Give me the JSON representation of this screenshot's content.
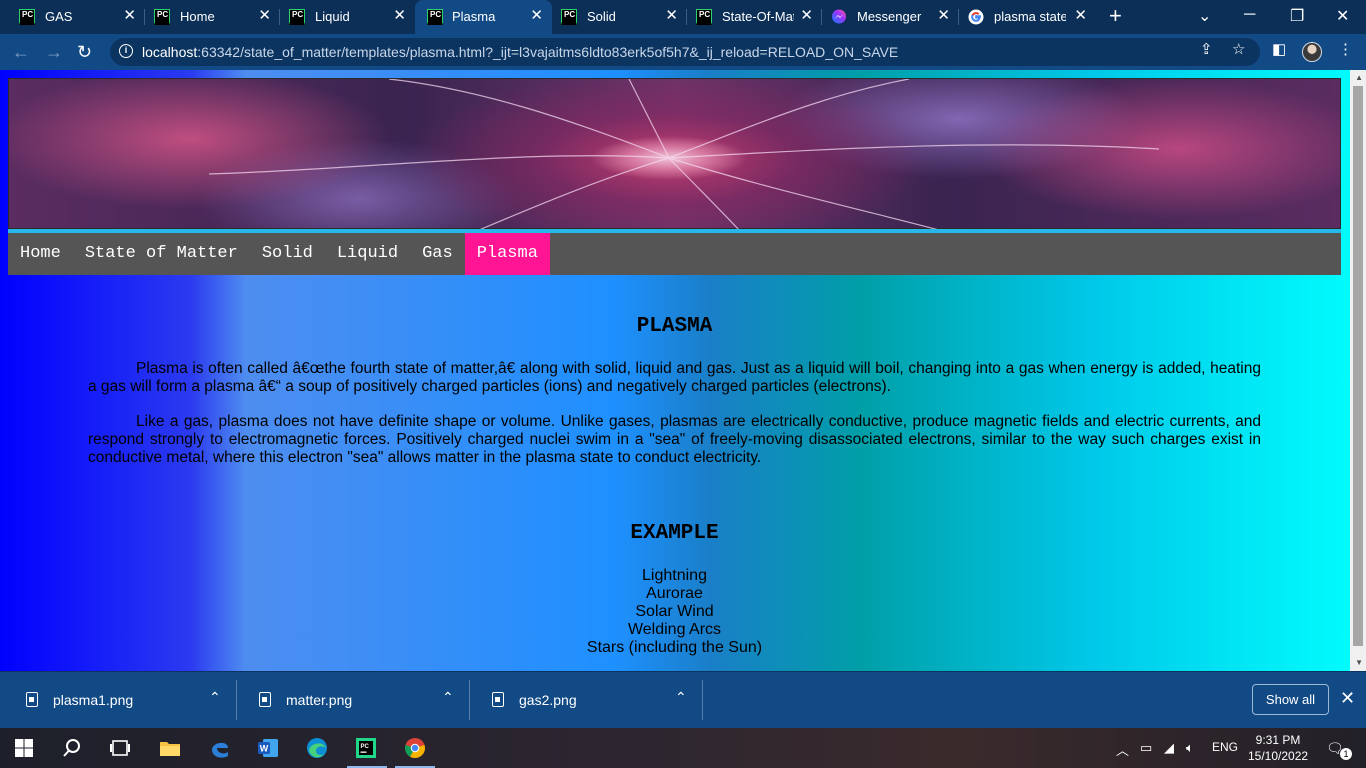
{
  "browser": {
    "tabs": [
      {
        "title": "GAS",
        "icon": "pycharm-icon",
        "active": false
      },
      {
        "title": "Home",
        "icon": "pycharm-icon",
        "active": false
      },
      {
        "title": "Liquid",
        "icon": "pycharm-icon",
        "active": false
      },
      {
        "title": "Plasma",
        "icon": "pycharm-icon",
        "active": true
      },
      {
        "title": "Solid",
        "icon": "pycharm-icon",
        "active": false
      },
      {
        "title": "State-Of-Matt",
        "icon": "pycharm-icon",
        "active": false
      },
      {
        "title": "Messenger",
        "icon": "messenger-icon",
        "active": false
      },
      {
        "title": "plasma state",
        "icon": "google-icon",
        "active": false
      }
    ],
    "url_host": "localhost",
    "url_rest": ":63342/state_of_matter/templates/plasma.html?_ijt=l3vajaitms6ldto83erk5of5h7&_ij_reload=RELOAD_ON_SAVE"
  },
  "page": {
    "nav": [
      "Home",
      "State of Matter",
      "Solid",
      "Liquid",
      "Gas",
      "Plasma"
    ],
    "active_nav": "Plasma",
    "heading": "PLASMA",
    "paragraph1": "Plasma is often called â€œthe fourth state of matter,â€ along with solid, liquid and gas. Just as a liquid will boil, changing into a gas when energy is added, heating a gas will form a plasma â€“ a soup of positively charged particles (ions) and negatively charged particles (electrons).",
    "paragraph2": "Like a gas, plasma does not have definite shape or volume. Unlike gases, plasmas are electrically conductive, produce magnetic fields and electric currents, and respond strongly to electromagnetic forces. Positively charged nuclei swim in a \"sea\" of freely-moving disassociated electrons, similar to the way such charges exist in conductive metal, where this electron \"sea\" allows matter in the plasma state to conduct electricity.",
    "example_heading": "EXAMPLE",
    "examples": [
      "Lightning",
      "Aurorae",
      "Solar Wind",
      "Welding Arcs",
      "Stars (including the Sun)"
    ]
  },
  "downloads": {
    "files": [
      "plasma1.png",
      "matter.png",
      "gas2.png"
    ],
    "show_all": "Show all"
  },
  "taskbar": {
    "language": "ENG",
    "time": "9:31 PM",
    "date": "15/10/2022",
    "notifications": "1"
  }
}
